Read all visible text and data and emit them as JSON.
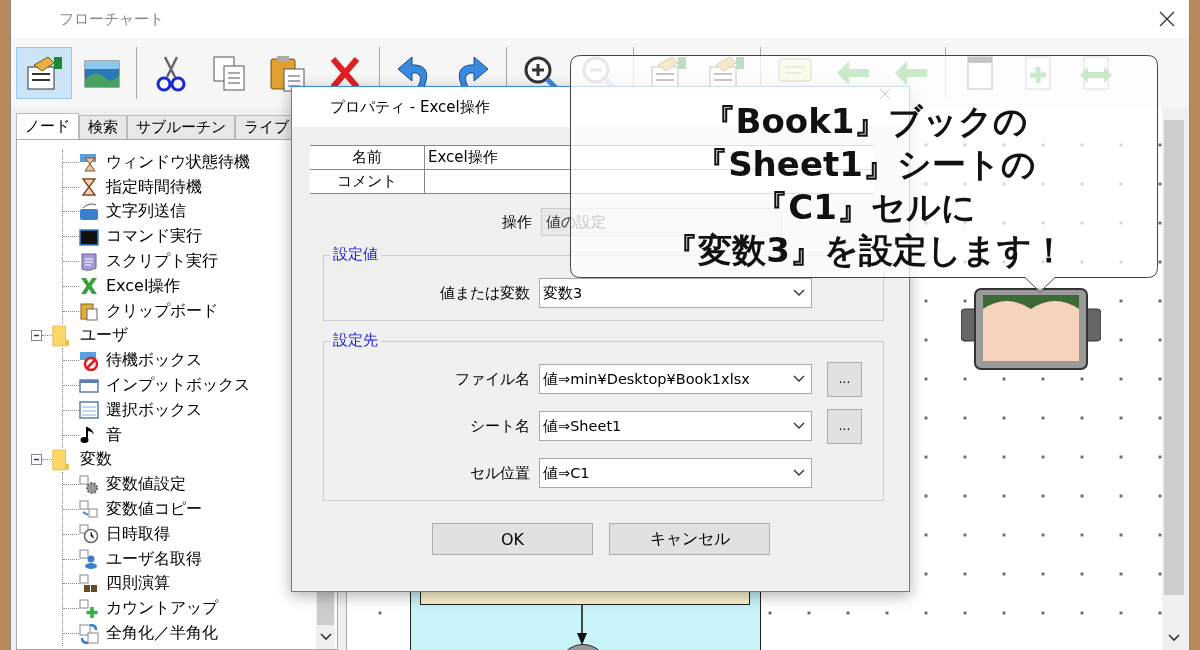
{
  "window": {
    "title": "フローチャート"
  },
  "toolbar_buttons": [
    {
      "selected": true
    },
    {
      "selected": false
    },
    {
      "selected": false
    },
    {
      "selected": false
    },
    {
      "selected": false
    },
    {
      "selected": false
    },
    {
      "selected": false
    },
    {
      "selected": false
    },
    {
      "selected": false
    },
    {
      "selected": false
    },
    {
      "selected": false
    },
    {
      "selected": false
    },
    {
      "selected": false
    },
    {
      "selected": false
    },
    {
      "selected": false
    },
    {
      "selected": false
    },
    {
      "selected": false
    },
    {
      "selected": false
    }
  ],
  "tabs": [
    {
      "label": "ノード",
      "selected": true
    },
    {
      "label": "検索",
      "selected": false
    },
    {
      "label": "サブルーチン",
      "selected": false
    },
    {
      "label": "ライブ",
      "selected": false
    }
  ],
  "tree": [
    {
      "children": [
        {
          "label": "ウィンドウ状態待機"
        },
        {
          "label": "指定時間待機"
        },
        {
          "label": "文字列送信"
        },
        {
          "label": "コマンド実行"
        },
        {
          "label": "スクリプト実行"
        },
        {
          "label": "Excel操作"
        },
        {
          "label": "クリップボード"
        }
      ]
    },
    {
      "label": "ユーザ",
      "expanded": true,
      "children": [
        {
          "label": "待機ボックス"
        },
        {
          "label": "インプットボックス"
        },
        {
          "label": "選択ボックス"
        },
        {
          "label": "音"
        }
      ]
    },
    {
      "label": "変数",
      "expanded": true,
      "children": [
        {
          "label": "変数値設定"
        },
        {
          "label": "変数値コピー"
        },
        {
          "label": "日時取得"
        },
        {
          "label": "ユーザ名取得"
        },
        {
          "label": "四則演算"
        },
        {
          "label": "カウントアップ"
        },
        {
          "label": "全角化／半角化"
        }
      ]
    }
  ],
  "dialog": {
    "title": "プロパティ - Excel操作",
    "props": [
      {
        "label": "名前",
        "value": "Excel操作"
      },
      {
        "label": "コメント"
      }
    ],
    "operation": {
      "label": "操作",
      "value": "値の設定",
      "disabled": true
    },
    "groups": [
      {
        "title": "設定値",
        "fields": [
          {
            "label": "値または変数",
            "value": "変数3",
            "browse": false
          }
        ]
      },
      {
        "title": "設定先",
        "fields": [
          {
            "label": "ファイル名",
            "value": "値⇒min¥Desktop¥Book1xlsx",
            "browse": true,
            "browse_label": "..."
          },
          {
            "label": "シート名",
            "value": "値⇒Sheet1",
            "browse": true,
            "browse_label": "..."
          },
          {
            "label": "セル位置",
            "value": "値⇒C1",
            "browse": false
          }
        ]
      }
    ],
    "buttons": [
      "OK",
      "キャンセル"
    ]
  },
  "callout": {
    "lines": [
      "『Book1』ブックの",
      "『Sheet1』シートの",
      "『C1』セルに",
      "『変数3』を設定します！"
    ]
  }
}
